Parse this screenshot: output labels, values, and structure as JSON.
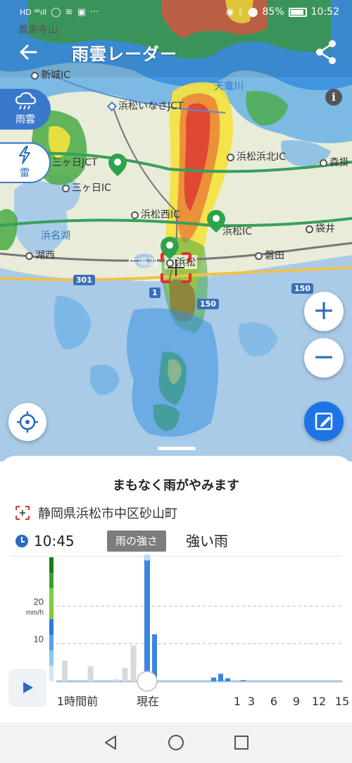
{
  "status_bar": {
    "left_text": "HD ⁴⁶ıll",
    "battery": "85%",
    "time": "10:52"
  },
  "app_bar": {
    "title": "雨雲レーダー"
  },
  "layers": [
    {
      "label": "雨雲",
      "icon": "rain-cloud-icon",
      "active": true
    },
    {
      "label": "雷",
      "icon": "lightning-icon",
      "active": false
    }
  ],
  "map_labels": {
    "shinshiro_ic": "新城IC",
    "hamamatsu_inasa_jct": "浜松いなさJCT",
    "tenryu": "天竜川",
    "hamamatsu_hamakita_ic": "浜松浜北IC",
    "mori": "森掛",
    "mikkabi_jct": "三ヶ日JCT",
    "mikkabi_ic": "三ヶ日IC",
    "hamamatsu_nishi_ic": "浜松西IC",
    "hamanako": "浜名湖",
    "hamamatsu_ic": "浜松IC",
    "fukuroi": "袋井",
    "kosai": "湖西",
    "sanaruko": "佐鳴湖",
    "hamamatsu": "浜松",
    "iwata": "磐田",
    "top_place": "鳳来寺山",
    "route_301": "301",
    "route_150a": "150",
    "route_150b": "150",
    "route_1": "1"
  },
  "controls": {
    "zoom_in": "+",
    "zoom_out": "−",
    "info": "i"
  },
  "sheet": {
    "headline": "まもなく雨がやみます",
    "location": "静岡県浜松市中区砂山町",
    "time": "10:45",
    "badge": "雨の強さ",
    "intensity": "強い雨"
  },
  "chart_data": {
    "type": "bar",
    "unit": "mm/h",
    "ylim": [
      0,
      33
    ],
    "yticks": [
      10,
      20
    ],
    "x_labels": [
      "1時間前",
      "現在",
      "1",
      "3",
      "6",
      "9",
      "12",
      "15"
    ],
    "past_values": [
      5.5,
      0,
      0,
      4,
      0,
      0,
      0.5,
      3.5,
      9.5
    ],
    "current_value": 33,
    "forecast_values": [
      12.5,
      1,
      2,
      0.8,
      0,
      0,
      0.3
    ],
    "legend_colors": [
      "#1a7a1a",
      "#3aa035",
      "#7bcf3e",
      "#8ac33a",
      "#2a7ad8",
      "#55a0e6",
      "#8cc6f0",
      "#cfe6fa"
    ]
  }
}
